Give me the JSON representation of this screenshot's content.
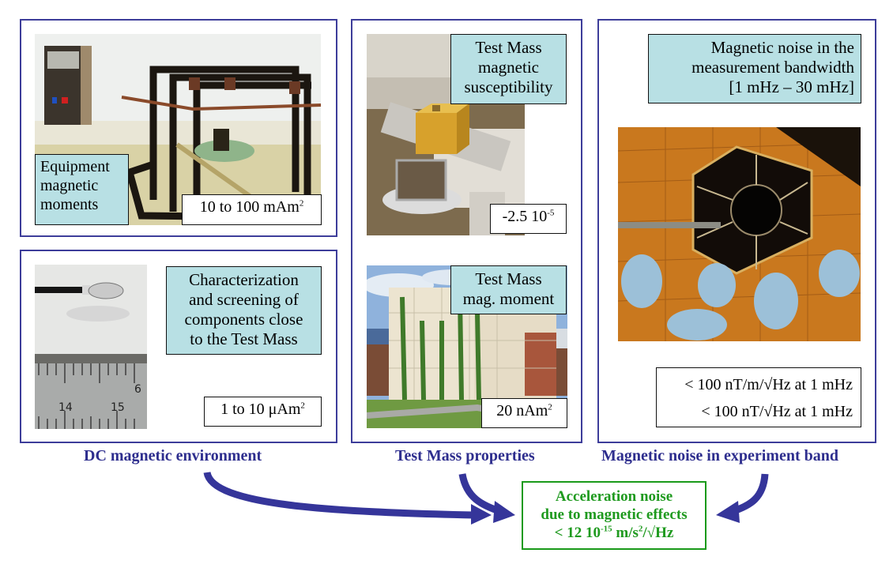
{
  "colors": {
    "panel_border": "#3d3d9a",
    "caption": "#2e2e8e",
    "label_bg": "#b8e0e4",
    "result": "#1f9a1f",
    "arrow": "#35359a"
  },
  "panels": {
    "equipment": {
      "photo": "magnetic-test-facility-coil-frame-photo",
      "label": "Equipment magnetic moments",
      "label_lines": [
        "Equipment",
        "magnetic",
        "moments"
      ],
      "value_text": "10 to 100 mAm",
      "value_sup": "2"
    },
    "components": {
      "photo": "small-component-on-ruler-photo",
      "label_lines": [
        "Characterization",
        "and screening of",
        "components close",
        "to the Test Mass"
      ],
      "value_text": "1 to 10 μAm",
      "value_sup": "2"
    },
    "susceptibility": {
      "photo": "gold-test-mass-cube-photo",
      "label_lines": [
        "Test Mass",
        "magnetic",
        "susceptibility"
      ],
      "value_text": "-2.5 10",
      "value_sup": "-5"
    },
    "moment": {
      "photo": "building-with-climbing-plants-photo",
      "label_lines": [
        "Test Mass",
        "mag. moment"
      ],
      "value_text": "20 nAm",
      "value_sup": "2"
    },
    "noise": {
      "photo": "spacecraft-top-view-with-technicians-photo",
      "label_lines": [
        "Magnetic noise in the",
        "measurement bandwidth",
        "[1 mHz – 30 mHz]"
      ],
      "value_lines": [
        "< 100 nT/m/√Hz at 1 mHz",
        "< 100 nT/√Hz at 1 mHz"
      ]
    }
  },
  "captions": {
    "dc": "DC magnetic environment",
    "tm": "Test Mass properties",
    "noise": "Magnetic noise in experiment band"
  },
  "result": {
    "line1": "Acceleration noise",
    "line2": "due to magnetic effects",
    "line3_prefix": "< 12 10",
    "line3_sup": "-15",
    "line3_mid": " m/s",
    "line3_sup2": "2",
    "line3_suffix": "/√Hz"
  }
}
